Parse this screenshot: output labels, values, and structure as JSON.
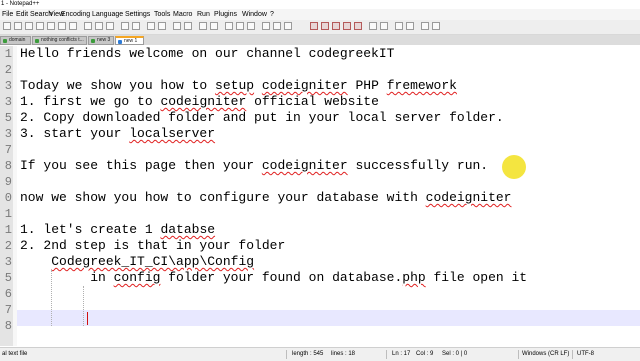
{
  "window": {
    "title": "1 - Notepad++"
  },
  "menu": [
    "File",
    "Edit",
    "Search",
    "View",
    "Encoding",
    "Language",
    "Settings",
    "Tools",
    "Macro",
    "Run",
    "Plugins",
    "Window",
    "?"
  ],
  "tabs": [
    {
      "label": "domain"
    },
    {
      "label": "nothing conflicts t..."
    },
    {
      "label": "new 3"
    },
    {
      "label": "new 1"
    }
  ],
  "editor": {
    "lines": [
      {
        "number": "1",
        "text": "Hello friends welcome on our channel codegreekIT"
      },
      {
        "number": "2",
        "text": ""
      },
      {
        "number": "3",
        "pre": "Today we show you how to ",
        "sq1": "setup",
        "mid": " ",
        "sq2": "codeigniter",
        "post": " PHP ",
        "sq3": "fremework"
      },
      {
        "number": "3",
        "pre": "1. first we go to ",
        "sq1": "codeigniter",
        "post": " official website"
      },
      {
        "number": "5",
        "text": "2. Copy downloaded folder and put in your local server folder."
      },
      {
        "number": "3",
        "pre": "3. start your ",
        "sq1": "localserver"
      },
      {
        "number": "7",
        "text": ""
      },
      {
        "number": "8",
        "pre": "If you see this page then your ",
        "sq1": "codeigniter",
        "post": " successfully run."
      },
      {
        "number": "9",
        "text": ""
      },
      {
        "number": "0",
        "pre": "now we show you how to configure your database with ",
        "sq1": "codeigniter"
      },
      {
        "number": "1",
        "text": ""
      },
      {
        "number": "1",
        "pre": "1. let's create 1 ",
        "sq1": "databse"
      },
      {
        "number": "2",
        "text": "2. 2nd step is that in your folder"
      },
      {
        "number": "3",
        "pre": "    ",
        "sq1": "Codegreek_IT_CI\\app\\Config"
      },
      {
        "number": "5",
        "pre": "         in ",
        "sq1": "config",
        "mid": " folder your found on database.",
        "sq2": "php",
        "post": " file open it"
      },
      {
        "number": "6",
        "text": ""
      },
      {
        "number": "7",
        "text": ""
      },
      {
        "number": "8",
        "text": ""
      }
    ]
  },
  "status": {
    "file_type": "al text file",
    "length": "length : 545",
    "lines": "lines : 18",
    "ln": "Ln : 17",
    "col": "Col : 9",
    "sel": "Sel : 0 | 0",
    "eol": "Windows (CR LF)",
    "encoding": "UTF-8"
  },
  "colors": {
    "current_line": "#e8e8ff",
    "squiggle": "#e02020",
    "cursor_highlight": "#f0dc00",
    "active_tab_accent": "#f5a623"
  }
}
